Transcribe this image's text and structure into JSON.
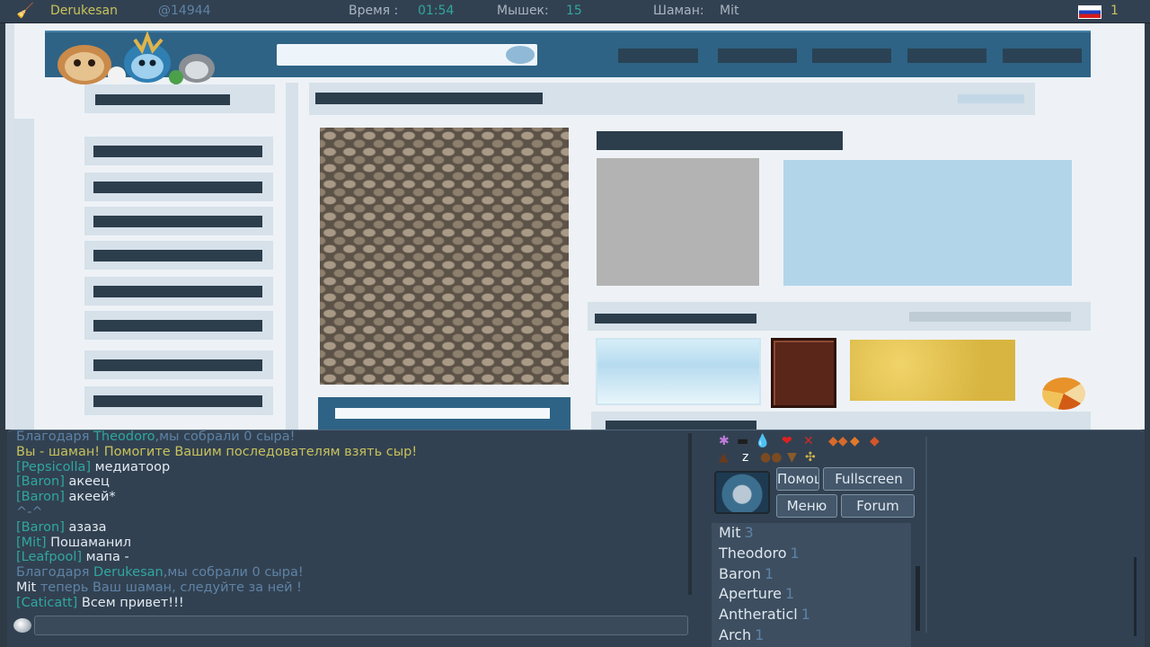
{
  "topbar": {
    "username": "Derukesan",
    "user_id": "@14944",
    "time_label": "Время :",
    "time_value": "01:54",
    "mice_label": "Мышек:",
    "mice_value": "15",
    "shaman_label": "Шаман:",
    "shaman_value": "Mit",
    "room_number": "1"
  },
  "chat": {
    "lines": [
      {
        "prefix": "",
        "tag": "",
        "text": "Благодаря ",
        "name": "Theodoro",
        "suffix": ",мы собрали 0 сыра!",
        "style": "system"
      },
      {
        "prefix": "",
        "tag": "",
        "text": "Вы - шаман! Помогите Вашим последователям взять сыр!",
        "name": "",
        "suffix": "",
        "style": "shaman"
      },
      {
        "tag": "[Pepsicolla]",
        "text": " медиатоор",
        "style": "player"
      },
      {
        "tag": "[Baron]",
        "text": " акеец",
        "style": "player"
      },
      {
        "tag": "[Baron]",
        "text": " акеей*",
        "style": "player"
      },
      {
        "tag": "",
        "text": "^-^",
        "style": "faded"
      },
      {
        "tag": "[Baron]",
        "text": " азаза",
        "style": "player"
      },
      {
        "tag": "[Mit]",
        "text": " Пошаманил",
        "style": "player"
      },
      {
        "tag": "[Leafpool]",
        "text": " мапа -",
        "style": "player"
      },
      {
        "text": "Благодаря ",
        "name": "Derukesan",
        "suffix": ",мы собрали 0 сыра!",
        "style": "system"
      },
      {
        "name": "Mit",
        "suffix": " теперь Ваш шаман, следуйте за ней !",
        "style": "shamannew"
      },
      {
        "tag": "[Caticatt]",
        "text": " Всем привет!!!",
        "style": "player"
      }
    ]
  },
  "buttons": {
    "help": "Помощь",
    "fullscreen": "Fullscreen",
    "menu": "Меню",
    "forum": "Forum"
  },
  "players": [
    {
      "name": "Mit",
      "score": "3"
    },
    {
      "name": "Theodoro",
      "score": "1"
    },
    {
      "name": "Baron",
      "score": "1"
    },
    {
      "name": "Aperture",
      "score": "1"
    },
    {
      "name": "Antheraticl",
      "score": "1"
    },
    {
      "name": "Arch",
      "score": "1"
    }
  ],
  "colors": {
    "system": "#5e83a6",
    "shaman": "#c8c25c",
    "tag": "#2fa7a0",
    "text": "#e2eaf1"
  }
}
